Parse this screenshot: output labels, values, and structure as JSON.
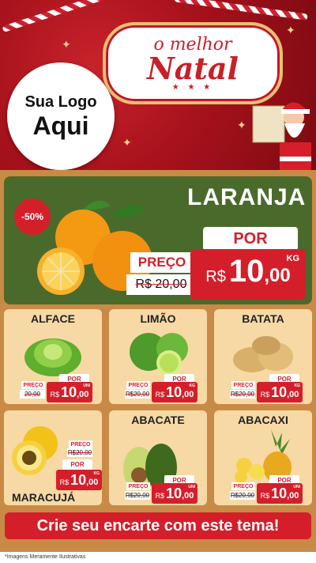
{
  "header": {
    "logo_line1": "Sua Logo",
    "logo_line2": "Aqui",
    "natal_line1": "o melhor",
    "natal_line2": "Natal",
    "natal_stars": "★ ★ ★"
  },
  "featured": {
    "discount": "-50%",
    "name": "LARANJA",
    "por": "POR",
    "preco_label": "PREÇO",
    "old_price": "R$ 20,00",
    "currency": "R$",
    "price_int": "10",
    "price_dec": ",00",
    "unit": "KG"
  },
  "products": [
    {
      "name": "ALFACE",
      "preco": "PREÇO",
      "old": "20,00",
      "por": "POR",
      "currency": "R$",
      "int": "10",
      "dec": ",00",
      "unit": "UNI"
    },
    {
      "name": "LIMÃO",
      "preco": "PREÇO",
      "old": "R$20,00",
      "por": "POR",
      "currency": "R$",
      "int": "10",
      "dec": ",00",
      "unit": "KG"
    },
    {
      "name": "BATATA",
      "preco": "PREÇO",
      "old": "R$20,00",
      "por": "POR",
      "currency": "R$",
      "int": "10",
      "dec": ",00",
      "unit": "KG"
    },
    {
      "name": "MARACUJÁ",
      "preco": "PREÇO",
      "old": "R$20,00",
      "por": "POR",
      "currency": "R$",
      "int": "10",
      "dec": ",00",
      "unit": "KG"
    },
    {
      "name": "ABACATE",
      "preco": "PREÇO",
      "old": "R$20,00",
      "por": "POR",
      "currency": "R$",
      "int": "10",
      "dec": ",00",
      "unit": "UNI"
    },
    {
      "name": "ABACAXI",
      "preco": "PREÇO",
      "old": "R$20,00",
      "por": "POR",
      "currency": "R$",
      "int": "10",
      "dec": ",00",
      "unit": "UNI"
    }
  ],
  "cta": "Crie seu encarte com este tema!",
  "footer": "*Imagens Meramente Ilustrativas",
  "colors": {
    "brand_red": "#d41f2b",
    "card_bg": "#f7d9a5",
    "panel_bg": "#c98a45",
    "feature_bg": "#4a6a2c"
  }
}
